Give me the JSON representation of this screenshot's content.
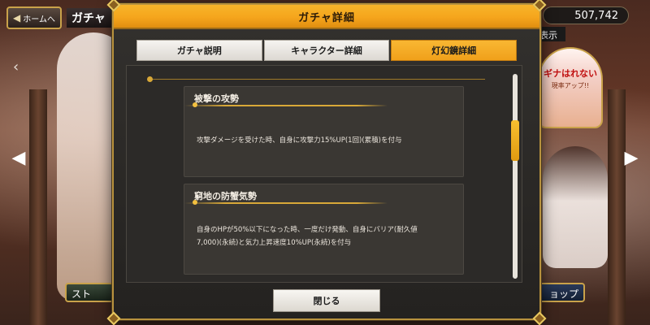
{
  "top_bar": {
    "home_button_label": "ホームへ",
    "home_button_icon": "back-arrow-icon",
    "screen_title": "ガチャ",
    "currency_amount": "507,742",
    "display_button_label": "表示"
  },
  "background": {
    "banner_text": "ギナはれない",
    "banner_subtext": "現率アップ!!",
    "bottom_left_button": "スト",
    "bottom_right_button": "ョップ"
  },
  "modal": {
    "title": "ガチャ詳細",
    "tabs": [
      {
        "label": "ガチャ説明",
        "active": false
      },
      {
        "label": "キャラクター詳細",
        "active": false
      },
      {
        "label": "灯幻鏡詳細",
        "active": true
      }
    ],
    "skills": [
      {
        "name": "被撃の攻勢",
        "description_lines": [
          "攻撃ダメージを受けた時、自身に攻撃力15%UP(1回)(累積)を付与"
        ]
      },
      {
        "name": "窮地の防蟹気勢",
        "description_lines": [
          "自身のHPが50%以下になった時、一度だけ発動、自身にバリア(耐久値",
          "7,000)(永続)と気力上昇速度10%UP(永続)を付与"
        ]
      }
    ],
    "close_button_label": "閉じる",
    "scroll_position": 0.28
  },
  "colors": {
    "header_gold": "#f5a51c",
    "active_tab": "#f9b733",
    "modal_bg": "#2c2a28",
    "accent_line": "#d8a838"
  }
}
